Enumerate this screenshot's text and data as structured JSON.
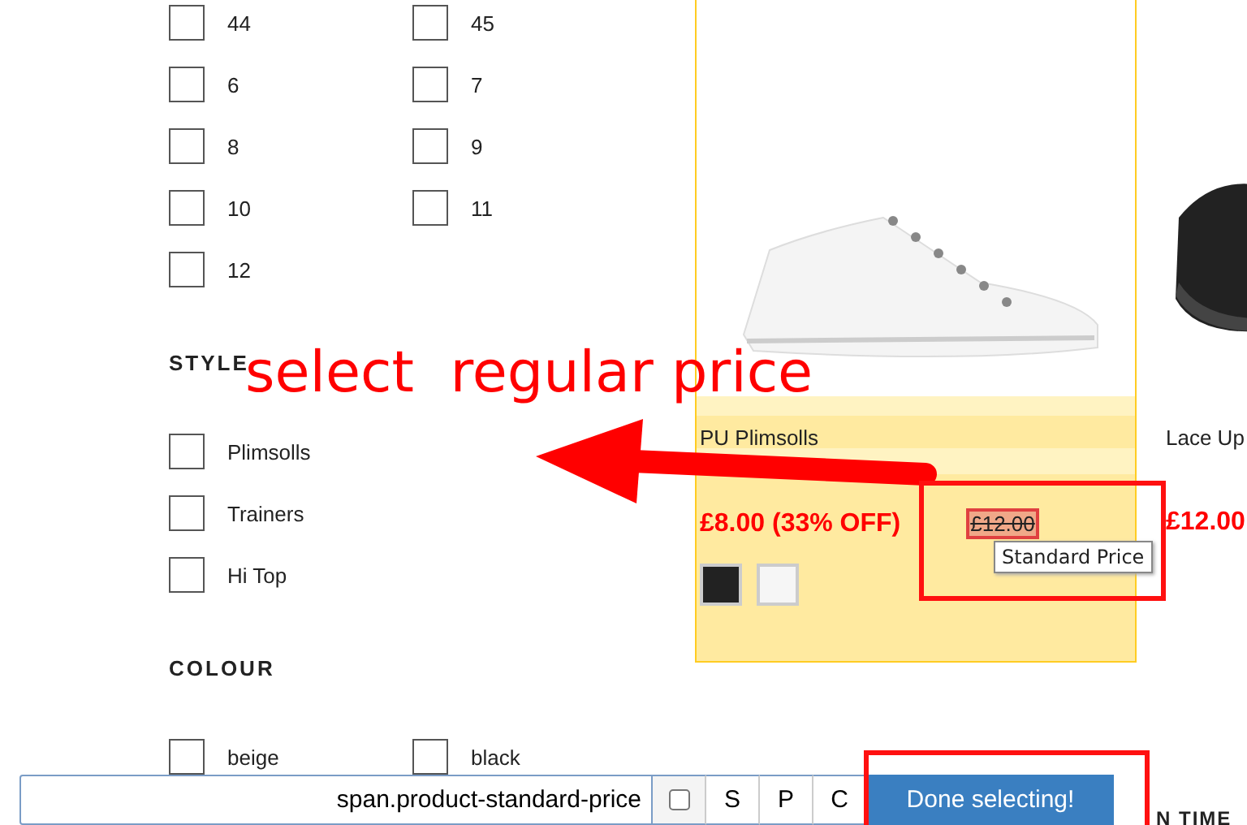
{
  "filters": [
    {
      "rows": [
        [
          {
            "label": "44",
            "checked": false
          },
          {
            "label": "45",
            "checked": false
          }
        ],
        [
          {
            "label": "6",
            "checked": false
          },
          {
            "label": "7",
            "checked": false
          }
        ],
        [
          {
            "label": "8",
            "checked": false
          },
          {
            "label": "9",
            "checked": false
          }
        ],
        [
          {
            "label": "10",
            "checked": false
          },
          {
            "label": "11",
            "checked": false
          }
        ],
        [
          {
            "label": "12",
            "checked": false
          }
        ]
      ]
    },
    {
      "heading": "STYLE",
      "rows": [
        [
          {
            "label": "Plimsolls",
            "checked": false
          }
        ],
        [
          {
            "label": "Trainers",
            "checked": false
          }
        ],
        [
          {
            "label": "Hi Top",
            "checked": false
          }
        ]
      ]
    },
    {
      "heading": "COLOUR",
      "rows": [
        [
          {
            "label": "beige",
            "checked": false
          },
          {
            "label": "black",
            "checked": false
          }
        ]
      ]
    }
  ],
  "products": [
    {
      "kind": "white_shoe",
      "name": "PU Plimsolls",
      "price": "£8.00 (33% OFF)",
      "standard_price": "£12.00",
      "selected": true,
      "swatches": [
        {
          "color": "#222222"
        },
        {
          "color": "#f6f6f6"
        }
      ]
    },
    {
      "kind": "black_shoe",
      "name": "Lace Up",
      "price": "£12.00",
      "selected": false
    }
  ],
  "tooltip": "Standard Price",
  "annotation": "select  regular price",
  "background_heading": "N TIME",
  "selector_toolbar": {
    "selector": "span.product-standard-price",
    "checked": false,
    "buttons": [
      "S",
      "P",
      "C"
    ],
    "done_button": "Done selecting!"
  }
}
